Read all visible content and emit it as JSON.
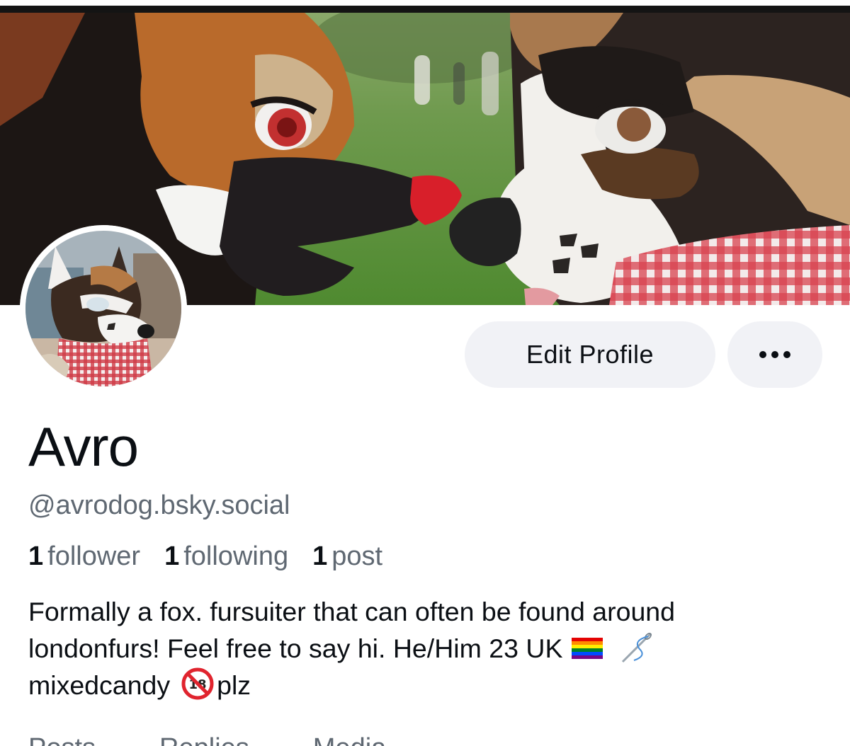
{
  "profile": {
    "display_name": "Avro",
    "handle": "@avrodog.bsky.social",
    "stats": [
      {
        "count": "1",
        "label": "follower"
      },
      {
        "count": "1",
        "label": "following"
      },
      {
        "count": "1",
        "label": "post"
      }
    ],
    "bio_lines": [
      "Formally a fox. fursuiter that can often be found around",
      "londonfurs! Feel free to say hi. He/Him 23 UK",
      "mixedcandy",
      "plz"
    ],
    "bio_emojis": [
      "rainbow-flag-icon",
      "sewing-needle-icon",
      "no-one-under-18-icon"
    ]
  },
  "actions": {
    "edit_profile_label": "Edit Profile",
    "more_icon": "ellipsis-icon"
  },
  "tabs": [
    "Posts",
    "Replies",
    "Media"
  ],
  "colors": {
    "text_primary": "#0b0f14",
    "text_secondary": "#5f6872",
    "button_bg": "#f1f2f6"
  }
}
